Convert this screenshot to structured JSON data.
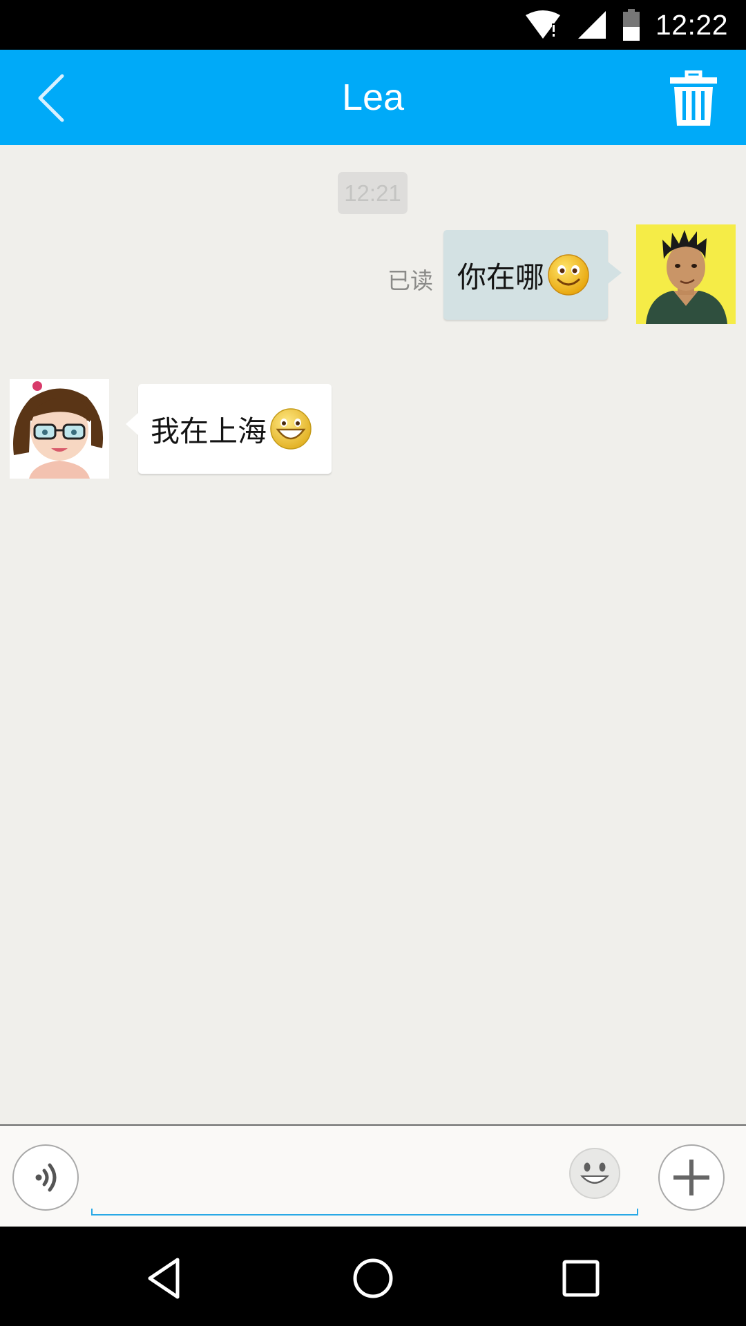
{
  "status_bar": {
    "time": "12:22",
    "icons": [
      "wifi-no-internet-icon",
      "cell-signal-icon",
      "battery-icon"
    ]
  },
  "header": {
    "title": "Lea",
    "back_icon": "chevron-left-icon",
    "delete_icon": "trash-icon",
    "color": "#00aaf8"
  },
  "chat": {
    "timestamp": "12:21",
    "messages": [
      {
        "direction": "outgoing",
        "text": "你在哪",
        "emoji": "smile-emoji",
        "status": "已读",
        "avatar": "male-avatar"
      },
      {
        "direction": "incoming",
        "text": "我在上海",
        "emoji": "grin-emoji",
        "avatar": "lea-avatar"
      }
    ]
  },
  "input_bar": {
    "value": "",
    "placeholder": "",
    "icons": [
      "voice-icon",
      "emoji-icon",
      "plus-icon"
    ]
  },
  "nav_bar": {
    "icons": [
      "nav-back-icon",
      "nav-home-icon",
      "nav-recents-icon"
    ]
  }
}
